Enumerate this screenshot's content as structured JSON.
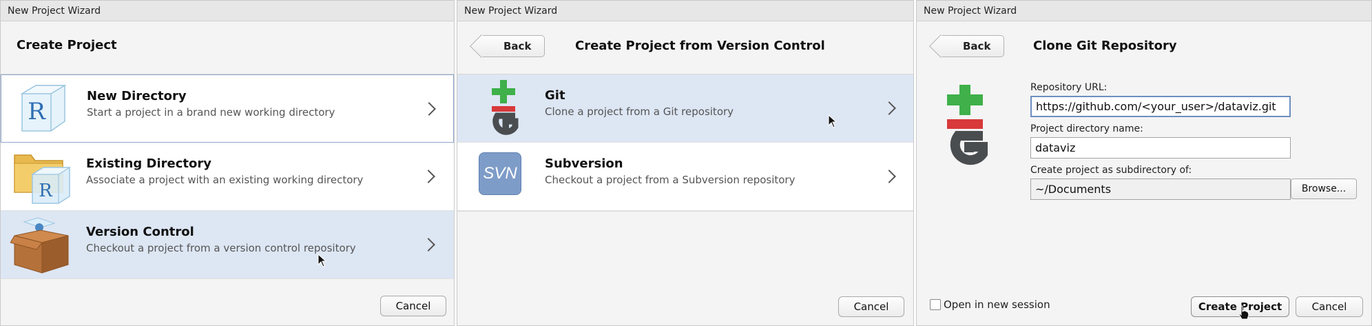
{
  "panel1": {
    "window_title": "New Project Wizard",
    "heading": "Create Project",
    "options": [
      {
        "title": "New Directory",
        "desc": "Start a project in a brand new working directory",
        "icon": "r-cube-icon"
      },
      {
        "title": "Existing Directory",
        "desc": "Associate a project with an existing working directory",
        "icon": "folder-r-icon"
      },
      {
        "title": "Version Control",
        "desc": "Checkout a project from a version control repository",
        "icon": "box-icon"
      }
    ],
    "cancel_label": "Cancel",
    "icon_letter": "R"
  },
  "panel2": {
    "window_title": "New Project Wizard",
    "back_label": "Back",
    "heading": "Create Project from Version Control",
    "options": [
      {
        "title": "Git",
        "desc": "Clone a project from a Git repository",
        "icon": "git-icon"
      },
      {
        "title": "Subversion",
        "desc": "Checkout a project from a Subversion repository",
        "icon": "svn-icon"
      }
    ],
    "svn_text": "SVN",
    "cancel_label": "Cancel"
  },
  "panel3": {
    "window_title": "New Project Wizard",
    "back_label": "Back",
    "heading": "Clone Git Repository",
    "repo_url_label": "Repository URL:",
    "repo_url_value": "https://github.com/<your_user>/dataviz.git",
    "dir_name_label": "Project directory name:",
    "dir_name_value": "dataviz",
    "subdir_label": "Create project as subdirectory of:",
    "subdir_value": "~/Documents",
    "browse_label": "Browse...",
    "new_session_label": "Open in new session",
    "new_session_checked": false,
    "create_label": "Create Project",
    "cancel_label": "Cancel"
  },
  "colors": {
    "selected_row": "#dde6f3",
    "git_green": "#3fb04a",
    "git_red": "#d8393a",
    "git_gray": "#4a4d50",
    "svn_blue": "#7e9cc8",
    "box_brown": "#b5713a"
  }
}
